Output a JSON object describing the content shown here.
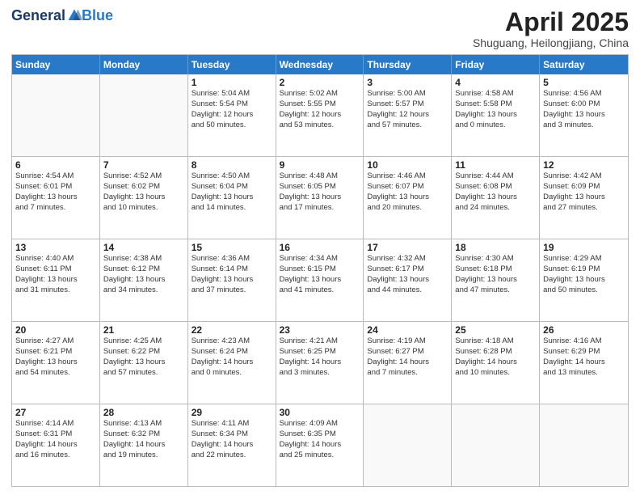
{
  "header": {
    "logo_general": "General",
    "logo_blue": "Blue",
    "month": "April 2025",
    "location": "Shuguang, Heilongjiang, China"
  },
  "days_of_week": [
    "Sunday",
    "Monday",
    "Tuesday",
    "Wednesday",
    "Thursday",
    "Friday",
    "Saturday"
  ],
  "weeks": [
    [
      {
        "day": "",
        "empty": true
      },
      {
        "day": "",
        "empty": true
      },
      {
        "day": "1",
        "info": "Sunrise: 5:04 AM\nSunset: 5:54 PM\nDaylight: 12 hours\nand 50 minutes."
      },
      {
        "day": "2",
        "info": "Sunrise: 5:02 AM\nSunset: 5:55 PM\nDaylight: 12 hours\nand 53 minutes."
      },
      {
        "day": "3",
        "info": "Sunrise: 5:00 AM\nSunset: 5:57 PM\nDaylight: 12 hours\nand 57 minutes."
      },
      {
        "day": "4",
        "info": "Sunrise: 4:58 AM\nSunset: 5:58 PM\nDaylight: 13 hours\nand 0 minutes."
      },
      {
        "day": "5",
        "info": "Sunrise: 4:56 AM\nSunset: 6:00 PM\nDaylight: 13 hours\nand 3 minutes."
      }
    ],
    [
      {
        "day": "6",
        "info": "Sunrise: 4:54 AM\nSunset: 6:01 PM\nDaylight: 13 hours\nand 7 minutes."
      },
      {
        "day": "7",
        "info": "Sunrise: 4:52 AM\nSunset: 6:02 PM\nDaylight: 13 hours\nand 10 minutes."
      },
      {
        "day": "8",
        "info": "Sunrise: 4:50 AM\nSunset: 6:04 PM\nDaylight: 13 hours\nand 14 minutes."
      },
      {
        "day": "9",
        "info": "Sunrise: 4:48 AM\nSunset: 6:05 PM\nDaylight: 13 hours\nand 17 minutes."
      },
      {
        "day": "10",
        "info": "Sunrise: 4:46 AM\nSunset: 6:07 PM\nDaylight: 13 hours\nand 20 minutes."
      },
      {
        "day": "11",
        "info": "Sunrise: 4:44 AM\nSunset: 6:08 PM\nDaylight: 13 hours\nand 24 minutes."
      },
      {
        "day": "12",
        "info": "Sunrise: 4:42 AM\nSunset: 6:09 PM\nDaylight: 13 hours\nand 27 minutes."
      }
    ],
    [
      {
        "day": "13",
        "info": "Sunrise: 4:40 AM\nSunset: 6:11 PM\nDaylight: 13 hours\nand 31 minutes."
      },
      {
        "day": "14",
        "info": "Sunrise: 4:38 AM\nSunset: 6:12 PM\nDaylight: 13 hours\nand 34 minutes."
      },
      {
        "day": "15",
        "info": "Sunrise: 4:36 AM\nSunset: 6:14 PM\nDaylight: 13 hours\nand 37 minutes."
      },
      {
        "day": "16",
        "info": "Sunrise: 4:34 AM\nSunset: 6:15 PM\nDaylight: 13 hours\nand 41 minutes."
      },
      {
        "day": "17",
        "info": "Sunrise: 4:32 AM\nSunset: 6:17 PM\nDaylight: 13 hours\nand 44 minutes."
      },
      {
        "day": "18",
        "info": "Sunrise: 4:30 AM\nSunset: 6:18 PM\nDaylight: 13 hours\nand 47 minutes."
      },
      {
        "day": "19",
        "info": "Sunrise: 4:29 AM\nSunset: 6:19 PM\nDaylight: 13 hours\nand 50 minutes."
      }
    ],
    [
      {
        "day": "20",
        "info": "Sunrise: 4:27 AM\nSunset: 6:21 PM\nDaylight: 13 hours\nand 54 minutes."
      },
      {
        "day": "21",
        "info": "Sunrise: 4:25 AM\nSunset: 6:22 PM\nDaylight: 13 hours\nand 57 minutes."
      },
      {
        "day": "22",
        "info": "Sunrise: 4:23 AM\nSunset: 6:24 PM\nDaylight: 14 hours\nand 0 minutes."
      },
      {
        "day": "23",
        "info": "Sunrise: 4:21 AM\nSunset: 6:25 PM\nDaylight: 14 hours\nand 3 minutes."
      },
      {
        "day": "24",
        "info": "Sunrise: 4:19 AM\nSunset: 6:27 PM\nDaylight: 14 hours\nand 7 minutes."
      },
      {
        "day": "25",
        "info": "Sunrise: 4:18 AM\nSunset: 6:28 PM\nDaylight: 14 hours\nand 10 minutes."
      },
      {
        "day": "26",
        "info": "Sunrise: 4:16 AM\nSunset: 6:29 PM\nDaylight: 14 hours\nand 13 minutes."
      }
    ],
    [
      {
        "day": "27",
        "info": "Sunrise: 4:14 AM\nSunset: 6:31 PM\nDaylight: 14 hours\nand 16 minutes."
      },
      {
        "day": "28",
        "info": "Sunrise: 4:13 AM\nSunset: 6:32 PM\nDaylight: 14 hours\nand 19 minutes."
      },
      {
        "day": "29",
        "info": "Sunrise: 4:11 AM\nSunset: 6:34 PM\nDaylight: 14 hours\nand 22 minutes."
      },
      {
        "day": "30",
        "info": "Sunrise: 4:09 AM\nSunset: 6:35 PM\nDaylight: 14 hours\nand 25 minutes."
      },
      {
        "day": "",
        "empty": true
      },
      {
        "day": "",
        "empty": true
      },
      {
        "day": "",
        "empty": true
      }
    ]
  ]
}
